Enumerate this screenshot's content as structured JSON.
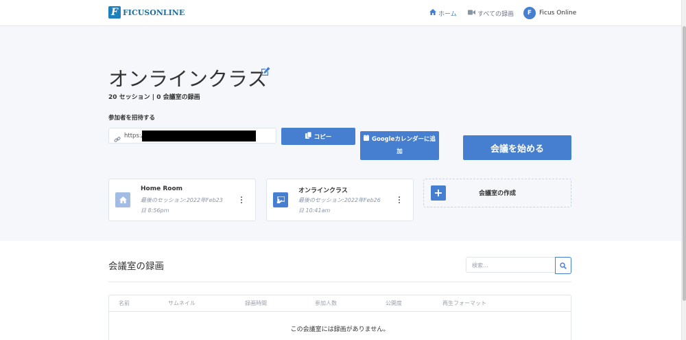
{
  "header": {
    "brand_logo_letter": "F",
    "brand_name": "FICUSONLINE",
    "nav_home": "ホーム",
    "nav_recordings": "すべての録画",
    "user_initial": "F",
    "user_name": "Ficus Online"
  },
  "room": {
    "title": "オンラインクラス",
    "subtitle": "20 セッション | 0 会議室の録画",
    "invite_label": "参加者を招待する",
    "invite_url": "https://",
    "copy_button": "コピー",
    "gcal_button_line1": "Googleカレンダーに追",
    "gcal_button_line2": "加",
    "start_button": "会議を始める"
  },
  "cards": [
    {
      "name": "Home Room",
      "session_line1": "最後のセッション:2022年Feb23",
      "session_line2": "日 8:56pm",
      "icon": "home-icon"
    },
    {
      "name": "オンラインクラス",
      "session_line1": "最後のセッション:2022年Feb26",
      "session_line2": "日 10:41am",
      "icon": "chalkboard-icon"
    }
  ],
  "create_room": {
    "label": "会議室の作成",
    "icon": "plus-icon"
  },
  "recordings": {
    "title": "会議室の録画",
    "search_placeholder": "検索...",
    "columns": [
      "名前",
      "サムネイル",
      "録画時間",
      "参加人数",
      "公開度",
      "再生フォーマット"
    ],
    "empty_message": "この会議室には録画がありません。"
  },
  "colors": {
    "accent": "#467fcf",
    "background": "#f5f7fb",
    "brand": "#1f7fb9"
  }
}
